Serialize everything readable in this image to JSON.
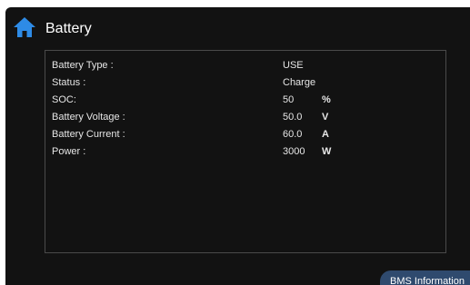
{
  "header": {
    "title": "Battery",
    "home_icon": "home-icon",
    "accent_color": "#2e8be6"
  },
  "details": [
    {
      "label": "Battery Type :",
      "value": "USE",
      "unit": ""
    },
    {
      "label": "Status :",
      "value": "Charge",
      "unit": ""
    },
    {
      "label": "SOC:",
      "value": "50",
      "unit": "%"
    },
    {
      "label": "Battery Voltage :",
      "value": "50.0",
      "unit": "V"
    },
    {
      "label": "Battery Current :",
      "value": "60.0",
      "unit": "A"
    },
    {
      "label": "Power :",
      "value": "3000",
      "unit": "W"
    }
  ],
  "footer": {
    "bms_button_label": "BMS Information"
  }
}
